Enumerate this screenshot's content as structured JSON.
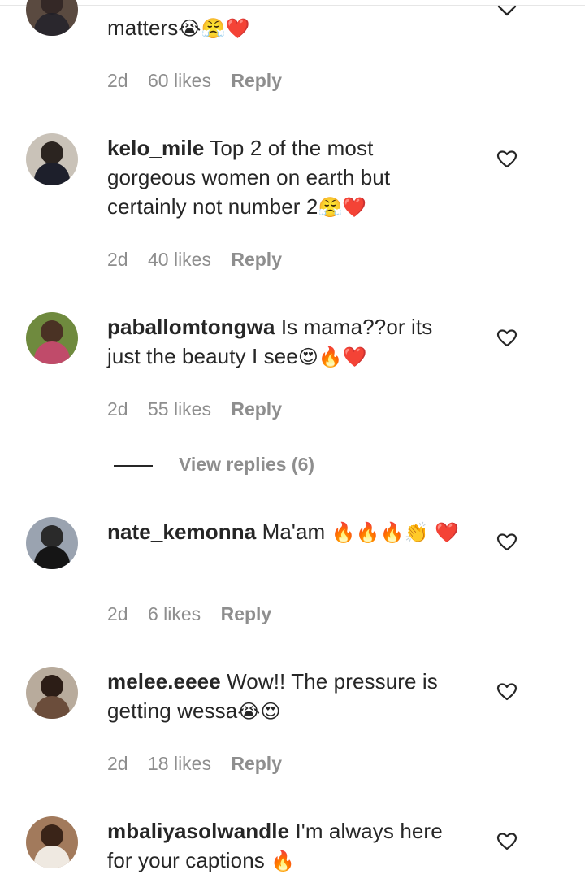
{
  "icons": {
    "like": "heart-outline-icon",
    "collapse": "chevron-down-icon"
  },
  "colors": {
    "text": "#262626",
    "muted": "#8e8e8e",
    "heart": "#e0162b"
  },
  "comments": [
    {
      "username": "",
      "text": "matters",
      "emoji": "😭😤❤️",
      "time": "2d",
      "likes": "60 likes",
      "reply": "Reply"
    },
    {
      "username": "kelo_mile",
      "text": " Top 2 of the most gorgeous women on earth but certainly not number 2",
      "emoji": "😤❤️",
      "time": "2d",
      "likes": "40 likes",
      "reply": "Reply"
    },
    {
      "username": "paballomtongwa",
      "text": " Is mama??or its just the beauty I see",
      "emoji": "😍🔥❤️",
      "time": "2d",
      "likes": "55 likes",
      "reply": "Reply"
    },
    {
      "username": "nate_kemonna",
      "text": " Ma'am ",
      "emoji": "🔥🔥🔥👏 ❤️",
      "time": "2d",
      "likes": "6 likes",
      "reply": "Reply"
    },
    {
      "username": "melee.eeee",
      "text": " Wow!! The pressure is getting wessa",
      "emoji": "😭😍",
      "time": "2d",
      "likes": "18 likes",
      "reply": "Reply"
    },
    {
      "username": "mbaliyasolwandle",
      "text": " I'm always here for your captions ",
      "emoji": "🔥",
      "time": "",
      "likes": "",
      "reply": ""
    }
  ],
  "view_replies": "View replies (6)"
}
